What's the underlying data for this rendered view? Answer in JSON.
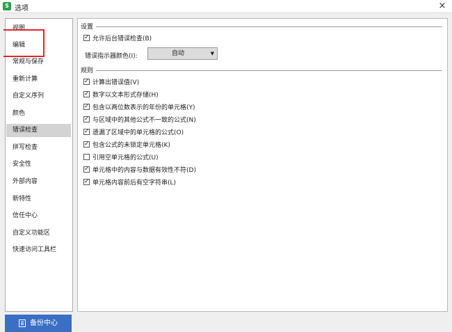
{
  "window": {
    "title": "选项",
    "app_icon_letter": "S",
    "close_symbol": "×"
  },
  "sidebar": {
    "items": [
      {
        "label": "视图"
      },
      {
        "label": "编辑"
      },
      {
        "label": "常规与保存"
      },
      {
        "label": "重新计算"
      },
      {
        "label": "自定义序列"
      },
      {
        "label": "颜色"
      },
      {
        "label": "错误检查",
        "selected": true
      },
      {
        "label": "拼写检查"
      },
      {
        "label": "安全性"
      },
      {
        "label": "外部内容"
      },
      {
        "label": "新特性"
      },
      {
        "label": "信任中心"
      },
      {
        "label": "自定义功能区"
      },
      {
        "label": "快速访问工具栏"
      }
    ]
  },
  "settings": {
    "title": "设置",
    "enable_bg_check": {
      "label": "允许后台错误检查(B)",
      "checked": true
    },
    "indicator_color": {
      "label": "错误指示器颜色(I):",
      "value": "自动"
    }
  },
  "rules": {
    "title": "规则",
    "items": [
      {
        "label": "计算出错误值(V)",
        "checked": true
      },
      {
        "label": "数字以文本形式存储(H)",
        "checked": true
      },
      {
        "label": "包含以两位数表示的年份的单元格(Y)",
        "checked": true
      },
      {
        "label": "与区域中的其他公式不一致的公式(N)",
        "checked": true
      },
      {
        "label": "遗漏了区域中的单元格的公式(O)",
        "checked": true
      },
      {
        "label": "包含公式的未锁定单元格(K)",
        "checked": true
      },
      {
        "label": "引用空单元格的公式(U)",
        "checked": false
      },
      {
        "label": "单元格中的内容与数据有效性不符(D)",
        "checked": true
      },
      {
        "label": "单元格内容前后有空字符串(L)",
        "checked": true
      }
    ]
  },
  "footer": {
    "backup_label": "备份中心"
  },
  "colors": {
    "accent_button": "#3a6fc4",
    "highlight_box": "#e0262a",
    "selected_item": "#d3d3d3"
  }
}
